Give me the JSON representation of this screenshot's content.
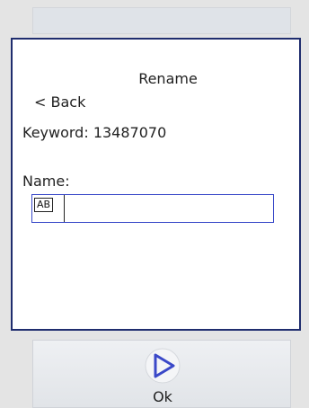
{
  "dialog": {
    "title": "Rename",
    "back_label": "< Back",
    "keyword_text": "Keyword: 13487070",
    "name_label": "Name:",
    "name_value": "",
    "input_mode": "AB"
  },
  "softkey": {
    "ok_label": "Ok",
    "ok_icon": "play-triangle-icon"
  },
  "colors": {
    "dialog_border": "#1f2d6e",
    "input_border": "#3848c8",
    "icon_stroke": "#3a48c8"
  }
}
